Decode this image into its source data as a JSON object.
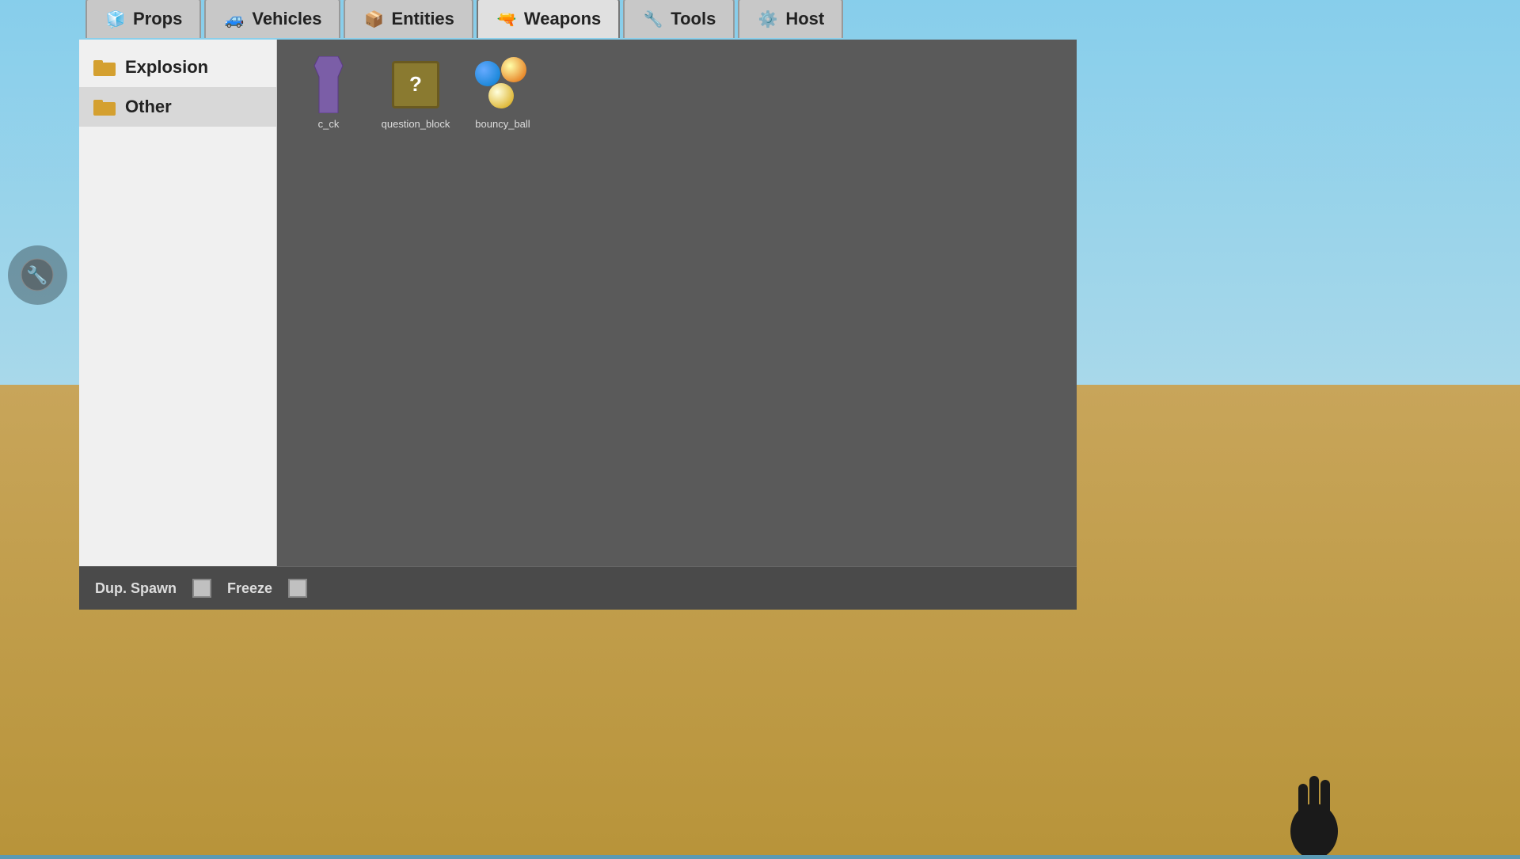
{
  "background": {
    "sky_color": "#87ceeb",
    "ground_color": "#c8a55a"
  },
  "tabs": [
    {
      "id": "props",
      "label": "Props",
      "icon": "🧊",
      "active": false
    },
    {
      "id": "vehicles",
      "label": "Vehicles",
      "icon": "🚙",
      "active": false
    },
    {
      "id": "entities",
      "label": "Entities",
      "icon": "📦",
      "active": false
    },
    {
      "id": "weapons",
      "label": "Weapons",
      "icon": "🔫",
      "active": true
    },
    {
      "id": "tools",
      "label": "Tools",
      "icon": "🔧",
      "active": false
    },
    {
      "id": "host",
      "label": "Host",
      "icon": "⚙️",
      "active": false
    }
  ],
  "sidebar": {
    "items": [
      {
        "id": "explosion",
        "label": "Explosion",
        "active": false
      },
      {
        "id": "other",
        "label": "Other",
        "active": true
      }
    ]
  },
  "grid_items": [
    {
      "id": "c_ck",
      "label": "c_ck",
      "type": "c_ck"
    },
    {
      "id": "question_block",
      "label": "question_block",
      "type": "question_block"
    },
    {
      "id": "bouncy_ball",
      "label": "bouncy_ball",
      "type": "bouncy_ball"
    }
  ],
  "bottom_bar": {
    "dup_spawn_label": "Dup. Spawn",
    "freeze_label": "Freeze"
  }
}
